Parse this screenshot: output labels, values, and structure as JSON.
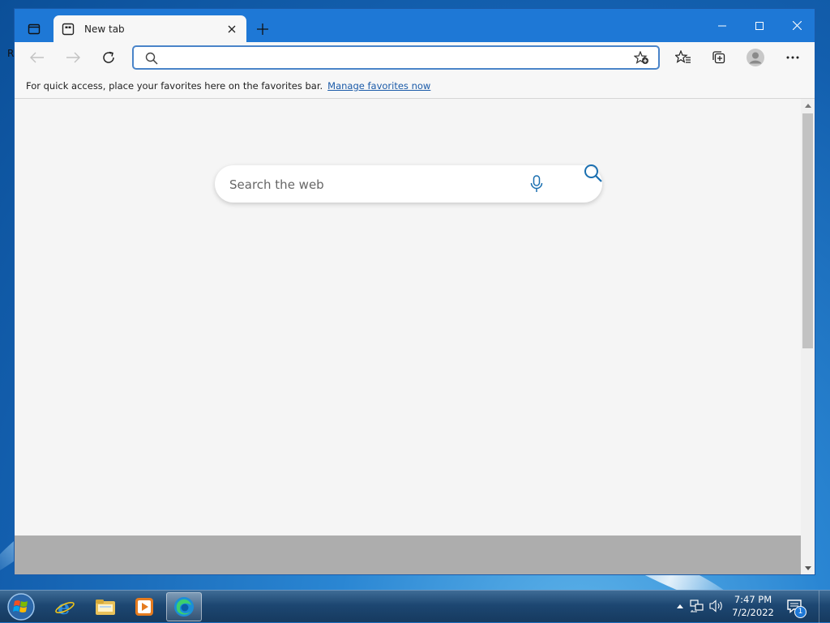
{
  "desktop": {
    "partial_label": "R"
  },
  "browser": {
    "tab": {
      "title": "New tab"
    },
    "address": {
      "value": "",
      "placeholder": ""
    },
    "favorites_bar": {
      "message": "For quick access, place your favorites here on the favorites bar.",
      "link": "Manage favorites now"
    },
    "search": {
      "placeholder": "Search the web"
    },
    "colors": {
      "titlebar": "#1e78d6",
      "content_bg": "#f5f5f5",
      "link": "#1a5aa8"
    }
  },
  "taskbar": {
    "apps": [
      "start-orb",
      "internet-explorer",
      "windows-explorer",
      "media-player",
      "microsoft-edge"
    ],
    "active_app": "microsoft-edge",
    "clock": {
      "time": "7:47 PM",
      "date": "7/2/2022"
    },
    "notification_count": "1"
  }
}
